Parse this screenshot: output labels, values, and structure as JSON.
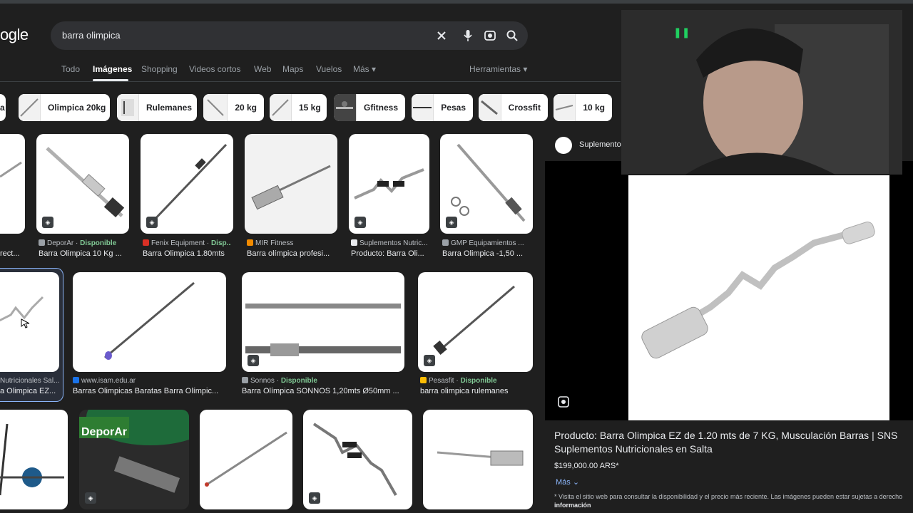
{
  "logo": "ogle",
  "search": {
    "query": "barra olimpica"
  },
  "tabs": [
    "Todo",
    "Imágenes",
    "Shopping",
    "Videos cortos",
    "Web",
    "Maps",
    "Vuelos",
    "Más"
  ],
  "tools_label": "Herramientas",
  "chips": [
    "a",
    "Olimpica 20kg",
    "Rulemanes",
    "20 kg",
    "15 kg",
    "Gfitness",
    "Pesas",
    "Crossfit",
    "10 kg"
  ],
  "row1": [
    {
      "source": "",
      "available": "",
      "title": "rect..."
    },
    {
      "source": "DeporAr",
      "available": "Disponible",
      "title": "Barra Olimpica 10 Kg ..."
    },
    {
      "source": "Fenix Equipment",
      "available": "Disp...",
      "title": "Barra Olimpica 1.80mts"
    },
    {
      "source": "MIR Fitness",
      "available": "",
      "title": "Barra olímpica profesi..."
    },
    {
      "source": "Suplementos Nutric...",
      "available": "",
      "title": "Producto: Barra Oli..."
    },
    {
      "source": "GMP Equipamientos ...",
      "available": "",
      "title": "Barra Olimpica -1,50 ..."
    }
  ],
  "row2": [
    {
      "source": "Nutricionales Sal...",
      "available": "",
      "title": "a Olimpica EZ..."
    },
    {
      "source": "www.isam.edu.ar",
      "available": "",
      "title": "Barras Olimpicas Baratas Barra Olímpic..."
    },
    {
      "source": "Sonnos",
      "available": "Disponible",
      "title": "Barra Olímpica SONNOS 1,20mts Ø50mm ..."
    },
    {
      "source": "Pesasfit",
      "available": "Disponible",
      "title": "barra olimpica rulemanes"
    }
  ],
  "row3_brand": "DeporAr",
  "panel": {
    "source": "Suplemento",
    "title": "Producto: Barra Olimpica EZ de 1.20 mts de 7 KG, Musculación Barras | SNS Suplementos Nutricionales en Salta",
    "price": "$199,000.00 ARS*",
    "more": "Más",
    "note": "* Visita el sitio web para consultar la disponibilidad y el precio más reciente. Las imágenes pueden estar sujetas a derecho",
    "note2": "información"
  },
  "colors": {
    "available": "#81c995",
    "link": "#8ab4f8",
    "background": "#1f1f1f"
  }
}
